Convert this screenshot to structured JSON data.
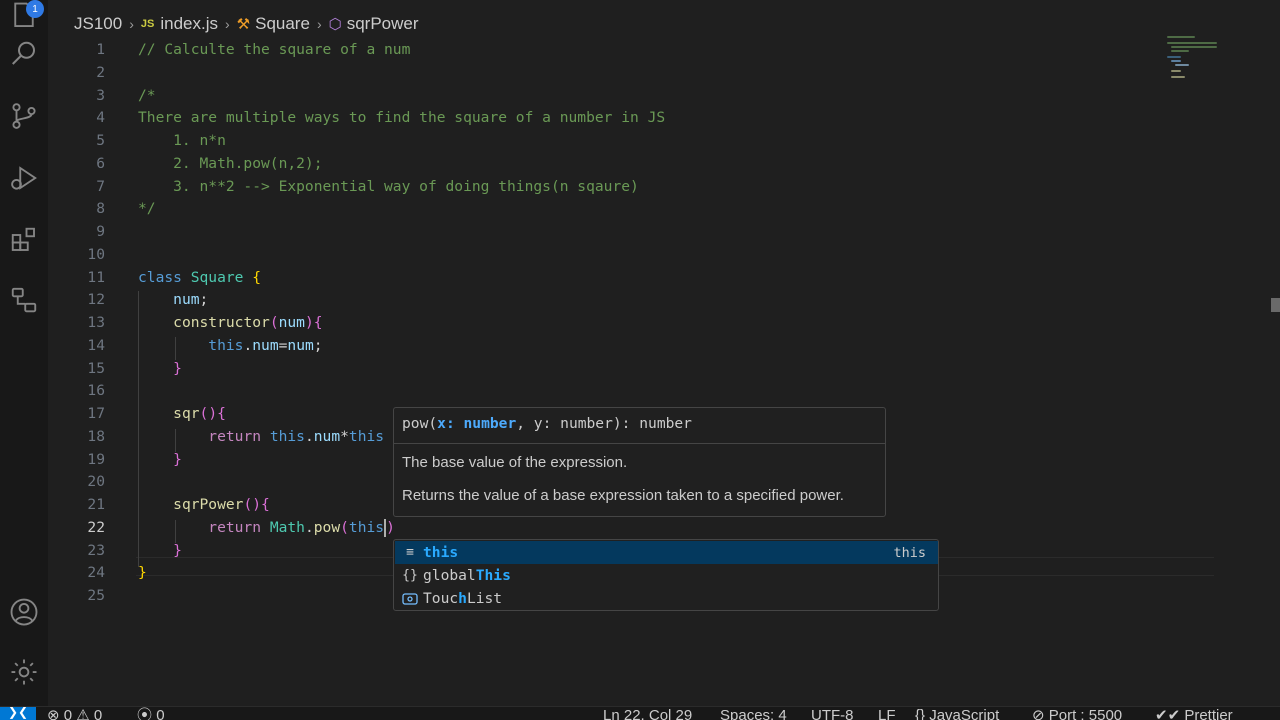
{
  "activity_bar": {
    "explorer_badge": "1",
    "icons": [
      "files-icon",
      "search-icon",
      "source-control-icon",
      "run-debug-icon",
      "extensions-icon",
      "remote-explorer-icon",
      "account-icon",
      "settings-gear-icon"
    ]
  },
  "breadcrumb": {
    "folder": "JS100",
    "file_badge": "JS",
    "file": "index.js",
    "class": "Square",
    "method": "sqrPower"
  },
  "editor": {
    "language": "javascript",
    "current_line": 22,
    "lines": [
      {
        "n": "1",
        "text": "// Calculte the square of a num"
      },
      {
        "n": "2",
        "text": ""
      },
      {
        "n": "3",
        "text": "/*"
      },
      {
        "n": "4",
        "text": "There are multiple ways to find the square of a number in JS"
      },
      {
        "n": "5",
        "text": "    1. n*n"
      },
      {
        "n": "6",
        "text": "    2. Math.pow(n,2);"
      },
      {
        "n": "7",
        "text": "    3. n**2 --> Exponential way of doing things(n sqaure)"
      },
      {
        "n": "8",
        "text": "*/"
      },
      {
        "n": "9",
        "text": ""
      },
      {
        "n": "10",
        "text": ""
      },
      {
        "n": "11",
        "text": "class Square {"
      },
      {
        "n": "12",
        "text": "    num;"
      },
      {
        "n": "13",
        "text": "    constructor(num){"
      },
      {
        "n": "14",
        "text": "        this.num=num;"
      },
      {
        "n": "15",
        "text": "    }"
      },
      {
        "n": "16",
        "text": ""
      },
      {
        "n": "17",
        "text": "    sqr(){"
      },
      {
        "n": "18",
        "text": "        return this.num*this"
      },
      {
        "n": "19",
        "text": "    }"
      },
      {
        "n": "20",
        "text": ""
      },
      {
        "n": "21",
        "text": "    sqrPower(){"
      },
      {
        "n": "22",
        "text": "        return Math.pow(this)"
      },
      {
        "n": "23",
        "text": "    }"
      },
      {
        "n": "24",
        "text": "}"
      },
      {
        "n": "25",
        "text": ""
      }
    ]
  },
  "parameter_hint": {
    "signature_prefix": "pow(",
    "active_param": "x: number",
    "signature_suffix": ", y: number): number",
    "param_doc": "The base value of the expression.",
    "function_doc": "Returns the value of a base expression taken to a specified power."
  },
  "suggestions": [
    {
      "icon": "keyword-icon",
      "prefix": "",
      "highlight": "this",
      "suffix": "",
      "detail": "this",
      "selected": true
    },
    {
      "icon": "namespace-icon",
      "prefix": "global",
      "highlight": "This",
      "suffix": "",
      "detail": "",
      "selected": false
    },
    {
      "icon": "interface-icon",
      "prefix": "Touc",
      "highlight": "h",
      "suffix": "List",
      "detail": "",
      "selected": false
    }
  ],
  "status_bar": {
    "errors": "0",
    "warnings": "0",
    "ports": "0",
    "position": "Ln 22, Col 29",
    "indentation": "Spaces: 4",
    "encoding": "UTF-8",
    "eol": "LF",
    "language": "JavaScript",
    "live_server": "Port : 5500",
    "formatter": "Prettier"
  },
  "colors": {
    "background": "#1f1f1f",
    "comment": "#6a9955",
    "keyword": "#569cd6",
    "accent": "#0078d4",
    "suggest_selected": "#04395e"
  }
}
